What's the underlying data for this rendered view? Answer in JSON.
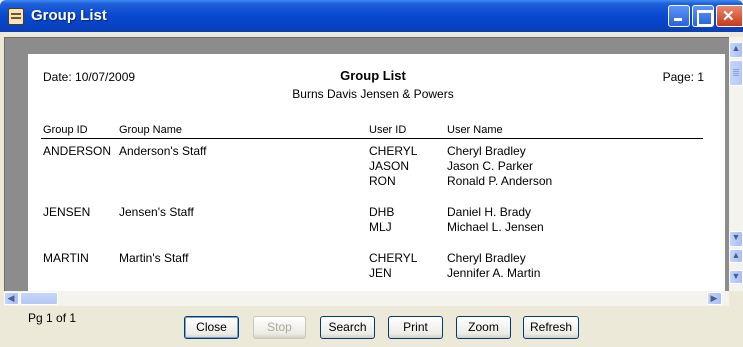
{
  "window": {
    "title": "Group List"
  },
  "report": {
    "date": "Date: 10/07/2009",
    "title": "Group List",
    "subtitle": "Burns Davis Jensen & Powers",
    "page": "Page: 1",
    "columns": [
      "Group ID",
      "Group Name",
      "User ID",
      "User Name"
    ],
    "groups": [
      {
        "id": "ANDERSON",
        "name": "Anderson's Staff",
        "users": [
          {
            "uid": "CHERYL",
            "uname": "Cheryl Bradley"
          },
          {
            "uid": "JASON",
            "uname": "Jason C. Parker"
          },
          {
            "uid": "RON",
            "uname": "Ronald P. Anderson"
          }
        ]
      },
      {
        "id": "JENSEN",
        "name": "Jensen's Staff",
        "users": [
          {
            "uid": "DHB",
            "uname": "Daniel H. Brady"
          },
          {
            "uid": "MLJ",
            "uname": "Michael L. Jensen"
          }
        ]
      },
      {
        "id": "MARTIN",
        "name": "Martin's Staff",
        "users": [
          {
            "uid": "CHERYL",
            "uname": "Cheryl Bradley"
          },
          {
            "uid": "JEN",
            "uname": "Jennifer A. Martin"
          }
        ]
      }
    ]
  },
  "footer": {
    "page_indicator": "Pg 1 of 1",
    "buttons": {
      "close": "Close",
      "stop": "Stop",
      "search": "Search",
      "print": "Print",
      "zoom": "Zoom",
      "refresh": "Refresh"
    }
  },
  "icons": {
    "app": "report-icon",
    "minimize": "minimize-icon",
    "maximize": "maximize-icon",
    "close": "close-icon",
    "scroll_up": "arrow-up-icon",
    "scroll_down": "arrow-down-icon",
    "scroll_left": "arrow-left-icon",
    "scroll_right": "arrow-right-icon"
  },
  "colors": {
    "titlebar": "#0a4bd0",
    "close_button": "#c8381a",
    "background": "#ece9d8"
  }
}
